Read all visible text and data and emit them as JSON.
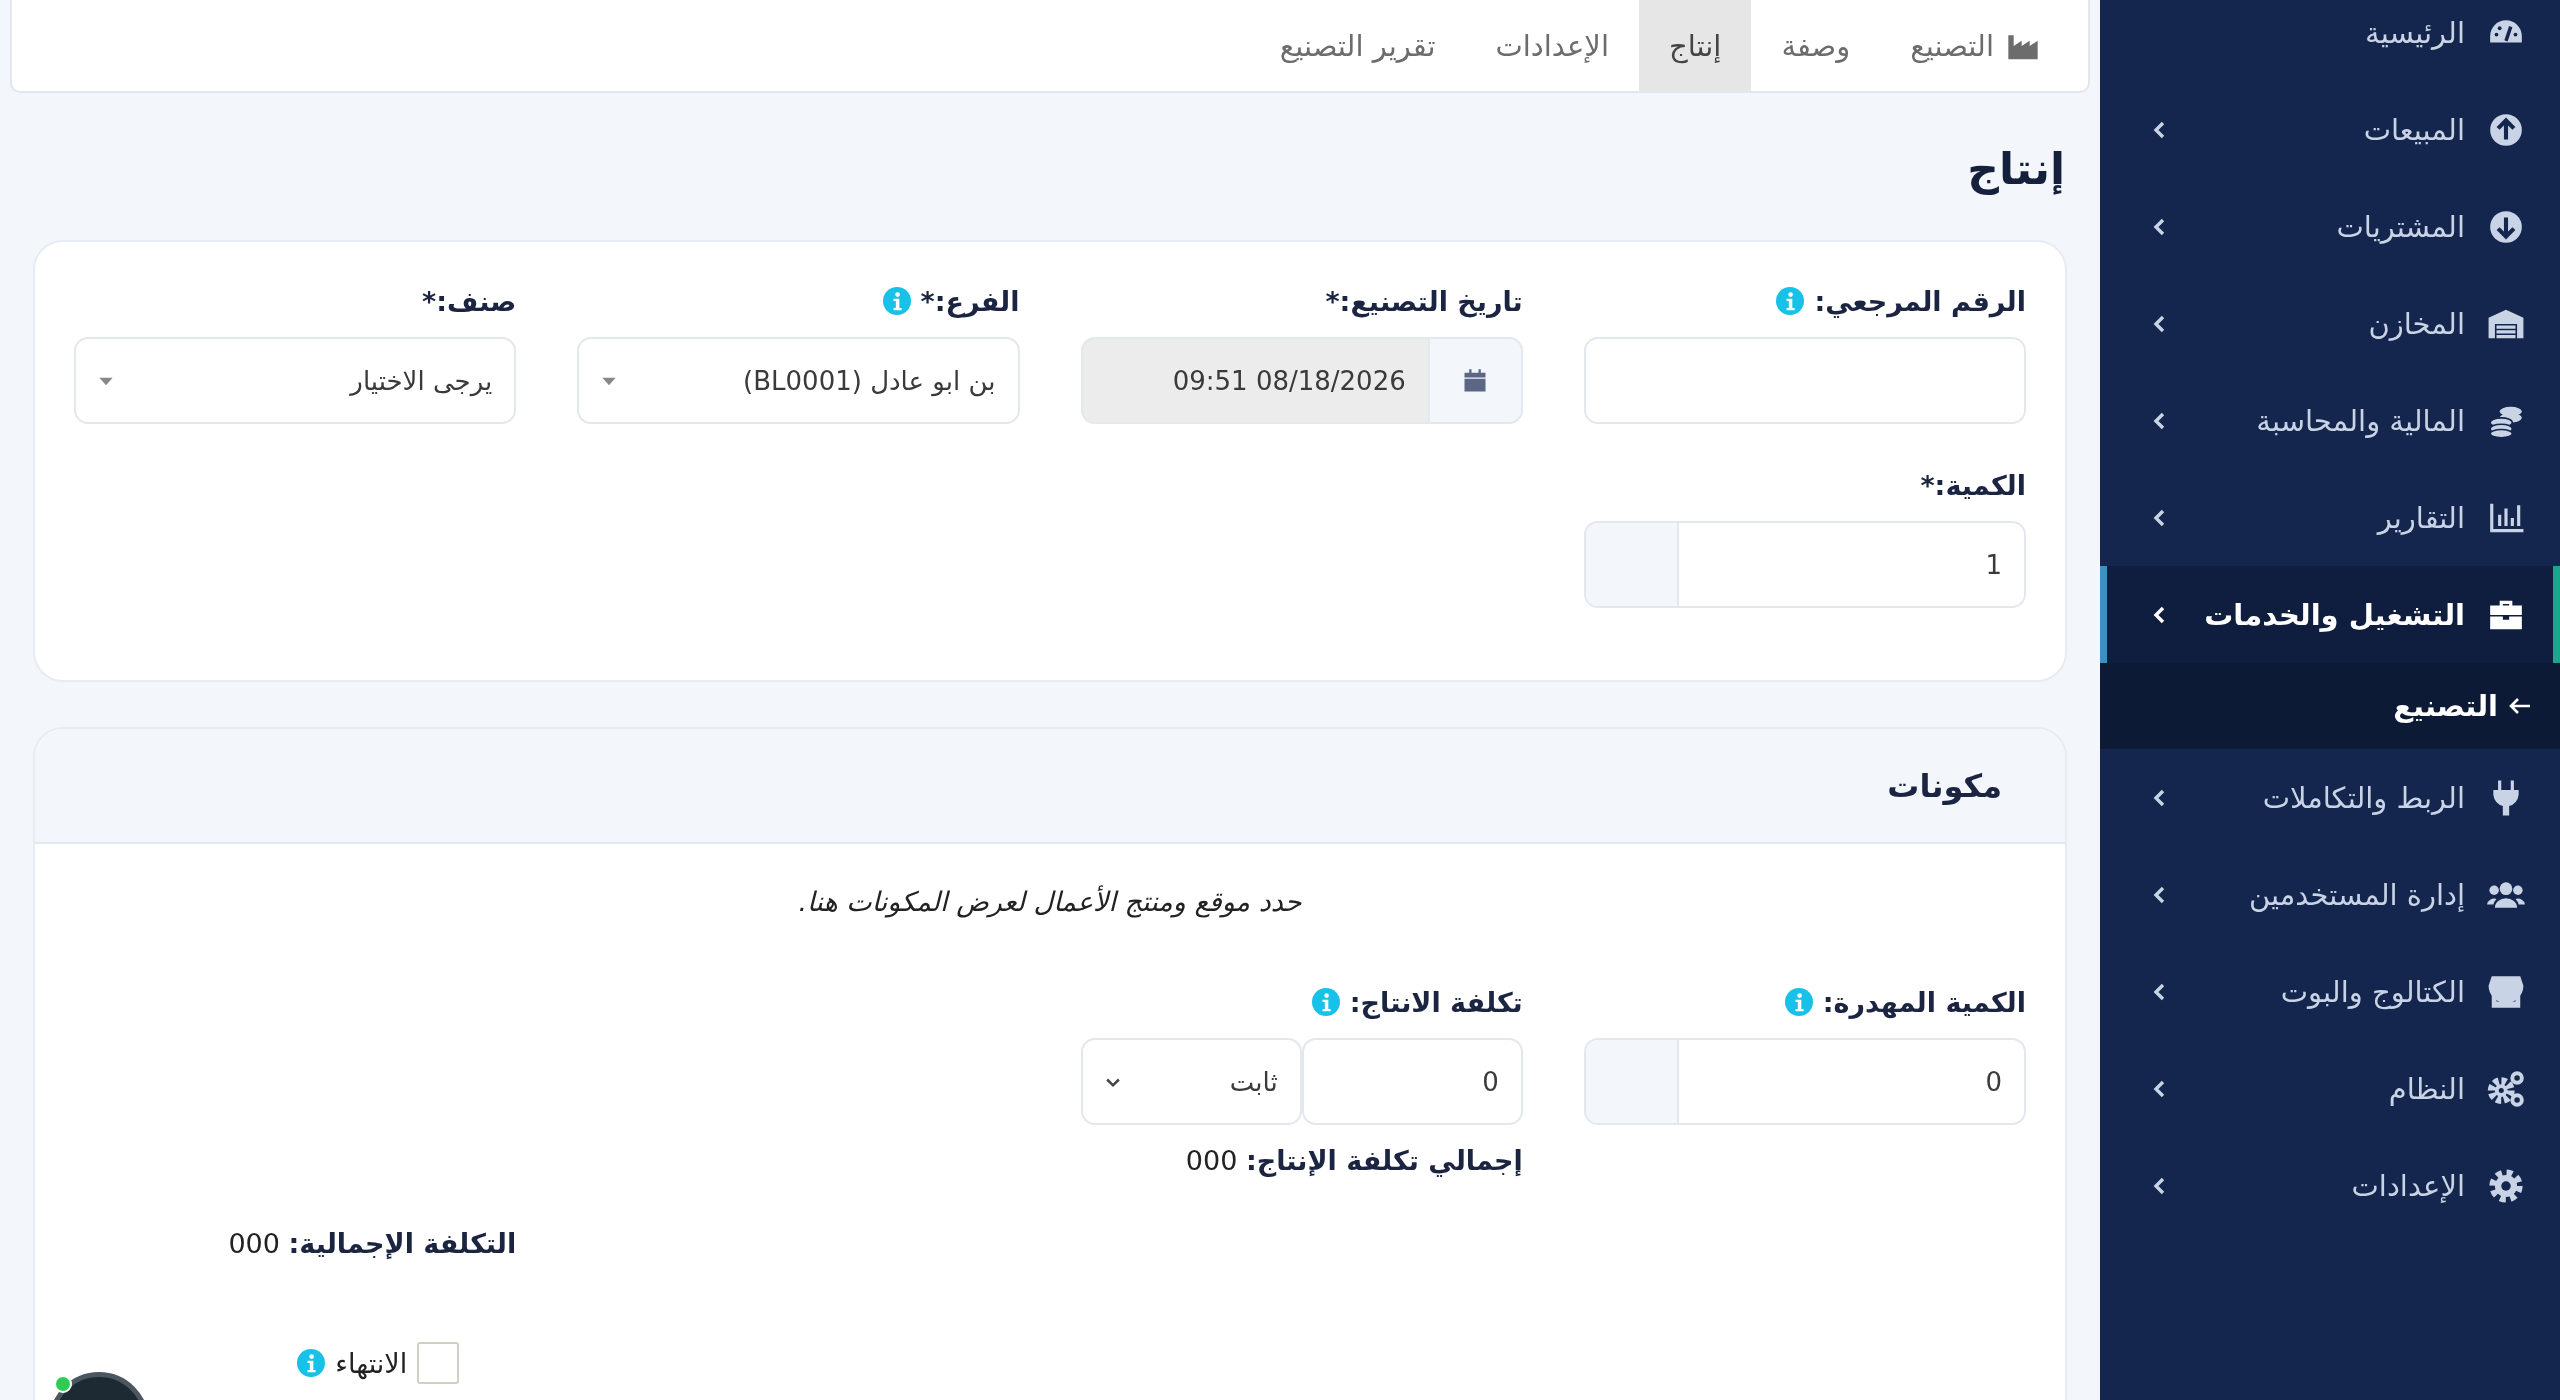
{
  "sidebar": {
    "items": [
      {
        "label": "الرئيسية",
        "expandable": false,
        "selected": false
      },
      {
        "label": "المبيعات",
        "expandable": true,
        "selected": false
      },
      {
        "label": "المشتريات",
        "expandable": true,
        "selected": false
      },
      {
        "label": "المخازن",
        "expandable": true,
        "selected": false
      },
      {
        "label": "المالية والمحاسبة",
        "expandable": true,
        "selected": false
      },
      {
        "label": "التقارير",
        "expandable": true,
        "selected": false
      },
      {
        "label": "التشغيل والخدمات",
        "expandable": true,
        "selected": true,
        "children": [
          {
            "label": "التصنيع",
            "selected": true
          }
        ]
      },
      {
        "label": "الربط والتكاملات",
        "expandable": true,
        "selected": false
      },
      {
        "label": "إدارة المستخدمين",
        "expandable": true,
        "selected": false
      },
      {
        "label": "الكتالوج والبوت",
        "expandable": true,
        "selected": false
      },
      {
        "label": "النظام",
        "expandable": true,
        "selected": false
      },
      {
        "label": "الإعدادات",
        "expandable": true,
        "selected": false
      }
    ]
  },
  "tabs": [
    {
      "label": "التصنيع",
      "kind": "with-icon",
      "selected": false
    },
    {
      "label": "وصفة",
      "kind": "plain",
      "selected": false
    },
    {
      "label": "إنتاج",
      "kind": "plain",
      "selected": true
    },
    {
      "label": "الإعدادات",
      "kind": "plain",
      "selected": false
    },
    {
      "label": "تقرير التصنيع",
      "kind": "plain",
      "selected": false
    }
  ],
  "page_title": "إنتاج",
  "main_form": {
    "fields": [
      {
        "kind": "text",
        "label": "الرقم المرجعي:",
        "info": true
      },
      {
        "kind": "date",
        "label": "تاريخ التصنيع:*",
        "info": false,
        "value": "09:51 08/18/2026"
      },
      {
        "kind": "select",
        "label": "الفرع:*",
        "info": true,
        "value": "بن ابو عادل (BL0001)"
      },
      {
        "kind": "select",
        "label": "صنف:*",
        "info": false,
        "value": "يرجى الاختيار"
      },
      {
        "kind": "addon-number",
        "label": "الكمية:*",
        "info": false,
        "value": "1"
      }
    ]
  },
  "components": {
    "title": "مكونات",
    "note": "حدد موقع ومنتج الأعمال لعرض المكونات هنا.",
    "fields": [
      {
        "kind": "addon-number",
        "label": "الكمية المهدرة:",
        "info": true,
        "value": "0"
      },
      {
        "kind": "cost",
        "label": "تكلفة الانتاج:",
        "info": true,
        "value": "0",
        "unit": "ثابت"
      }
    ],
    "production_total": {
      "label": "إجمالي تكلفة الإنتاج:",
      "value": "000"
    },
    "grand_total": {
      "label": "التكلفة الإجمالية:",
      "value": "000"
    },
    "finish": {
      "label": "الانتهاء",
      "checked": false,
      "info": true
    }
  }
}
